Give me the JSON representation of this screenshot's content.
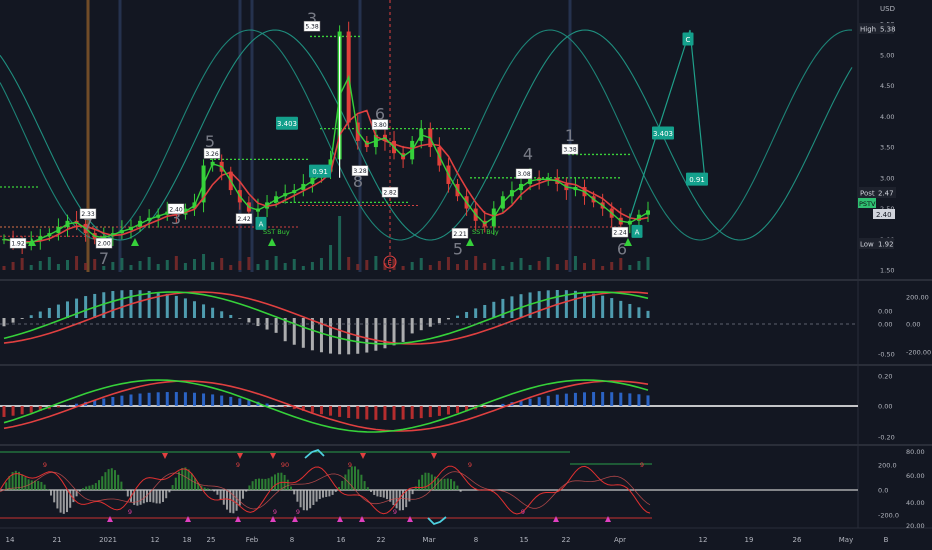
{
  "chart_data": [
    {
      "type": "candlestick",
      "currency": "USD",
      "y_ticks": [
        "5.50",
        "5.00",
        "4.50",
        "4.00",
        "3.50",
        "3.00",
        "2.50",
        "2.00",
        "1.50"
      ],
      "ylim": [
        1.5,
        5.6
      ],
      "high_label": "High",
      "high_value": "5.38",
      "post_label": "Post",
      "post_value": "2.47",
      "pstv_label": "PSTV",
      "last_value": "2.40",
      "low_label": "Low",
      "low_value": "1.92",
      "close_series": [
        2.0,
        1.95,
        1.92,
        1.97,
        2.05,
        2.1,
        2.2,
        2.3,
        2.25,
        2.1,
        2.0,
        2.05,
        2.1,
        2.15,
        2.2,
        2.3,
        2.35,
        2.4,
        2.45,
        2.4,
        2.5,
        2.6,
        3.2,
        3.26,
        3.1,
        2.8,
        2.6,
        2.45,
        2.5,
        2.6,
        2.7,
        2.75,
        2.8,
        2.9,
        3.0,
        3.1,
        3.3,
        5.38,
        3.9,
        3.6,
        3.5,
        3.7,
        3.6,
        3.4,
        3.3,
        3.6,
        3.8,
        3.5,
        3.2,
        2.9,
        2.7,
        2.5,
        2.3,
        2.21,
        2.5,
        2.7,
        2.8,
        2.9,
        3.0,
        2.95,
        3.0,
        2.9,
        2.8,
        2.85,
        2.7,
        2.6,
        2.5,
        2.35,
        2.24,
        2.3,
        2.4,
        2.47
      ],
      "price_tags": [
        {
          "text": "1.92",
          "price": 1.92
        },
        {
          "text": "2.33",
          "price": 2.4
        },
        {
          "text": "2.00",
          "price": 1.92
        },
        {
          "text": "2.40",
          "price": 2.48
        },
        {
          "text": "3.26",
          "price": 3.38
        },
        {
          "text": "2.42",
          "price": 2.32
        },
        {
          "text": "5.38",
          "price": 5.45
        },
        {
          "text": "3.80",
          "price": 3.85
        },
        {
          "text": "3.28",
          "price": 3.1
        },
        {
          "text": "2.82",
          "price": 2.75
        },
        {
          "text": "3.08",
          "price": 3.05
        },
        {
          "text": "2.21",
          "price": 2.08
        },
        {
          "text": "3.38",
          "price": 3.45
        },
        {
          "text": "2.24",
          "price": 2.1
        }
      ],
      "teal_tags": [
        {
          "text": "3.403",
          "price": 3.88
        },
        {
          "text": "0.91",
          "price": 3.1
        },
        {
          "text": "3.403",
          "price": 3.72
        },
        {
          "text": "0.91",
          "price": 2.97
        },
        {
          "text": "A",
          "price": 2.25
        },
        {
          "text": "A",
          "price": 2.12
        },
        {
          "text": "C",
          "price": 5.25
        }
      ],
      "wave_labels": [
        {
          "text": "7",
          "price": 2.15
        },
        {
          "text": "7",
          "price": 1.6
        },
        {
          "text": "3",
          "price": 2.25
        },
        {
          "text": "5",
          "price": 3.5
        },
        {
          "text": "3",
          "price": 5.5
        },
        {
          "text": "6",
          "price": 3.95
        },
        {
          "text": "8",
          "price": 2.85
        },
        {
          "text": "5",
          "price": 1.75
        },
        {
          "text": "4",
          "price": 3.3
        },
        {
          "text": "1",
          "price": 3.6
        },
        {
          "text": "6",
          "price": 1.75
        }
      ],
      "annotations": [
        "SST Buy",
        "SST Buy",
        "E"
      ],
      "x_ticks": [
        "14",
        "21",
        "2021",
        "12",
        "18",
        "25",
        "Feb",
        "8",
        "16",
        "22",
        "Mar",
        "8",
        "15",
        "22",
        "Apr",
        "12",
        "19",
        "26",
        "May",
        "B"
      ]
    },
    {
      "type": "macd",
      "y_ticks_right": [
        "200.00",
        "0.00",
        "-200.00"
      ],
      "y_ticks_left": [
        "0.00",
        "0.00",
        "-0.50"
      ]
    },
    {
      "type": "oscillator",
      "y_ticks": [
        "0.20",
        "0.00",
        "-0.20"
      ]
    },
    {
      "type": "oscillator",
      "y_ticks_right": [
        "80.00",
        "60.00",
        "40.00",
        "20.00"
      ],
      "y_ticks_left": [
        "200.0",
        "0.0",
        "-200.0"
      ],
      "markers": [
        "9",
        "9",
        "9",
        "9",
        "90",
        "9",
        "9",
        "9",
        "9",
        "9",
        "9"
      ]
    }
  ]
}
